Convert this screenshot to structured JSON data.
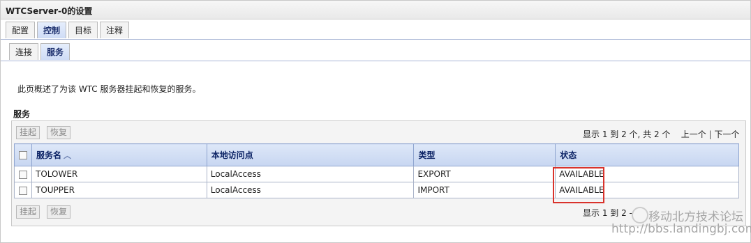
{
  "window": {
    "title": "WTCServer-0的设置"
  },
  "tabs": [
    {
      "label": "配置",
      "active": false
    },
    {
      "label": "控制",
      "active": true
    },
    {
      "label": "目标",
      "active": false
    },
    {
      "label": "注释",
      "active": false
    }
  ],
  "subtabs": [
    {
      "label": "连接",
      "active": false
    },
    {
      "label": "服务",
      "active": true
    }
  ],
  "description": "此页概述了为该 WTC 服务器挂起和恢复的服务。",
  "section_title": "服务",
  "toolbar": {
    "suspend_label": "挂起",
    "resume_label": "恢复"
  },
  "pager_top": {
    "showing": "显示 1 到 2 个, 共 2 个",
    "prev": "上一个",
    "sep": "|",
    "next": "下一个"
  },
  "pager_bottom": {
    "showing": "显示 1 到 2 -"
  },
  "table": {
    "headers": [
      "服务名",
      "本地访问点",
      "类型",
      "状态"
    ],
    "rows": [
      {
        "name": "TOLOWER",
        "access_point": "LocalAccess",
        "type": "EXPORT",
        "status": "AVAILABLE"
      },
      {
        "name": "TOUPPER",
        "access_point": "LocalAccess",
        "type": "IMPORT",
        "status": "AVAILABLE"
      }
    ]
  },
  "watermark": {
    "line1": "移动北方技术论坛",
    "line2": "http://bbs.landingbj.com"
  },
  "colors": {
    "highlight": "#d9322b",
    "header_text": "#0d2466"
  }
}
